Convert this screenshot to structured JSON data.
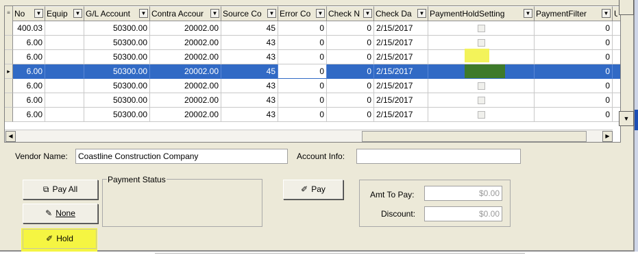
{
  "grid": {
    "columns": [
      {
        "label": "No"
      },
      {
        "label": "Equip"
      },
      {
        "label": "G/L Account"
      },
      {
        "label": "Contra Accour"
      },
      {
        "label": "Source Co"
      },
      {
        "label": "Error Co"
      },
      {
        "label": "Check N"
      },
      {
        "label": "Check Da"
      },
      {
        "label": "PaymentHoldSetting"
      },
      {
        "label": "PaymentFilter"
      },
      {
        "label": "U"
      }
    ],
    "rows": [
      {
        "no": "400.03",
        "equip": "",
        "gl": "50300.00",
        "contra": "20002.00",
        "source": "45",
        "error": "0",
        "checkno": "0",
        "date": "2/15/2017",
        "hold": false,
        "filter": "0"
      },
      {
        "no": "6.00",
        "equip": "",
        "gl": "50300.00",
        "contra": "20002.00",
        "source": "43",
        "error": "0",
        "checkno": "0",
        "date": "2/15/2017",
        "hold": false,
        "filter": "0"
      },
      {
        "no": "6.00",
        "equip": "",
        "gl": "50300.00",
        "contra": "20002.00",
        "source": "43",
        "error": "0",
        "checkno": "0",
        "date": "2/15/2017",
        "hold": true,
        "filter": "0"
      },
      {
        "no": "6.00",
        "equip": "",
        "gl": "50300.00",
        "contra": "20002.00",
        "source": "45",
        "error": "0",
        "checkno": "0",
        "date": "2/15/2017",
        "hold": false,
        "filter": "0",
        "selected": true
      },
      {
        "no": "6.00",
        "equip": "",
        "gl": "50300.00",
        "contra": "20002.00",
        "source": "43",
        "error": "0",
        "checkno": "0",
        "date": "2/15/2017",
        "hold": false,
        "filter": "0"
      },
      {
        "no": "6.00",
        "equip": "",
        "gl": "50300.00",
        "contra": "20002.00",
        "source": "43",
        "error": "0",
        "checkno": "0",
        "date": "2/15/2017",
        "hold": false,
        "filter": "0"
      },
      {
        "no": "6.00",
        "equip": "",
        "gl": "50300.00",
        "contra": "20002.00",
        "source": "43",
        "error": "0",
        "checkno": "0",
        "date": "2/15/2017",
        "hold": false,
        "filter": "0"
      }
    ]
  },
  "vendor": {
    "label": "Vendor Name:",
    "value": "Coastline Construction Company"
  },
  "account": {
    "label": "Account Info:",
    "value": ""
  },
  "buttons": {
    "pay_all": "Pay All",
    "none": "None",
    "hold": "Hold",
    "pay": "Pay"
  },
  "payment_status": {
    "title": "Payment Status"
  },
  "amounts": {
    "amt_label": "Amt To Pay:",
    "amt_value": "$0.00",
    "discount_label": "Discount:",
    "discount_value": "$0.00"
  },
  "colors": {
    "selection": "#316ac5",
    "highlight": "#f3f35a",
    "window": "#ece9d8"
  }
}
